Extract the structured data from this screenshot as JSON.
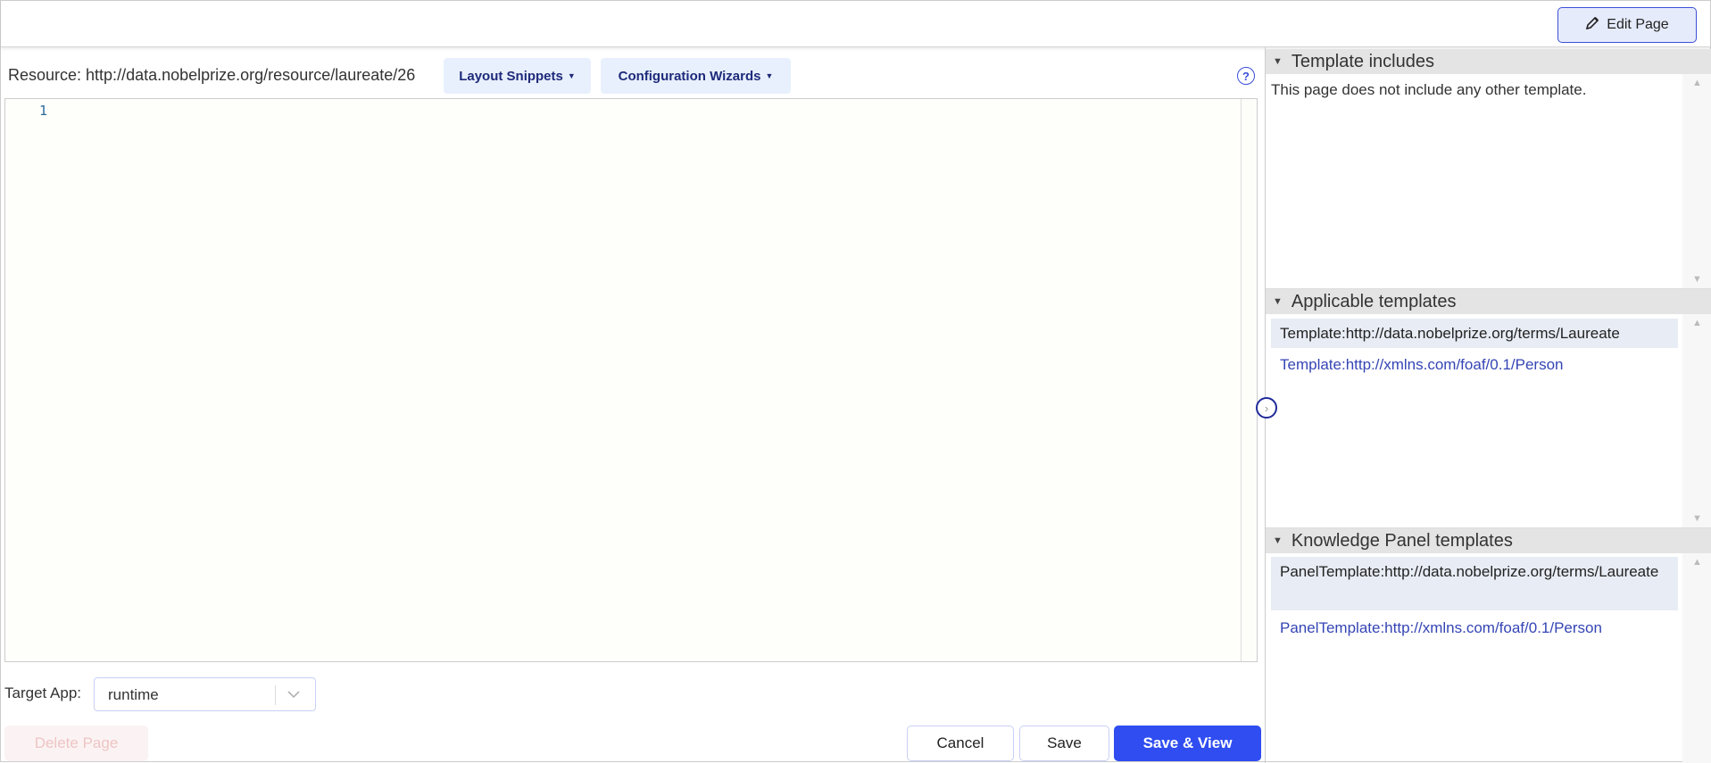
{
  "toolbar": {
    "edit_page": "Edit Page",
    "edit_icon": "pencil-icon"
  },
  "editor": {
    "resource_label": "Resource: http://data.nobelprize.org/resource/laureate/26",
    "layout_snippets": "Layout Snippets",
    "configuration_wizards": "Configuration Wizards",
    "help": "?",
    "line_numbers": [
      "1"
    ]
  },
  "form": {
    "target_app_label": "Target App:",
    "target_app_value": "runtime",
    "delete": "Delete Page",
    "cancel": "Cancel",
    "save": "Save",
    "save_view": "Save & View"
  },
  "panel": {
    "includes": {
      "title": "Template includes",
      "empty": "This page does not include any other template."
    },
    "applicable": {
      "title": "Applicable templates",
      "items": [
        "Template:http://data.nobelprize.org/terms/Laureate",
        "Template:http://xmlns.com/foaf/0.1/Person"
      ]
    },
    "knowledge": {
      "title": "Knowledge Panel templates",
      "items": [
        "PanelTemplate:http://data.nobelprize.org/terms/Laureate",
        "PanelTemplate:http://xmlns.com/foaf/0.1/Person"
      ]
    }
  },
  "colors": {
    "accent": "#2f4df0",
    "link": "#3545b5"
  }
}
